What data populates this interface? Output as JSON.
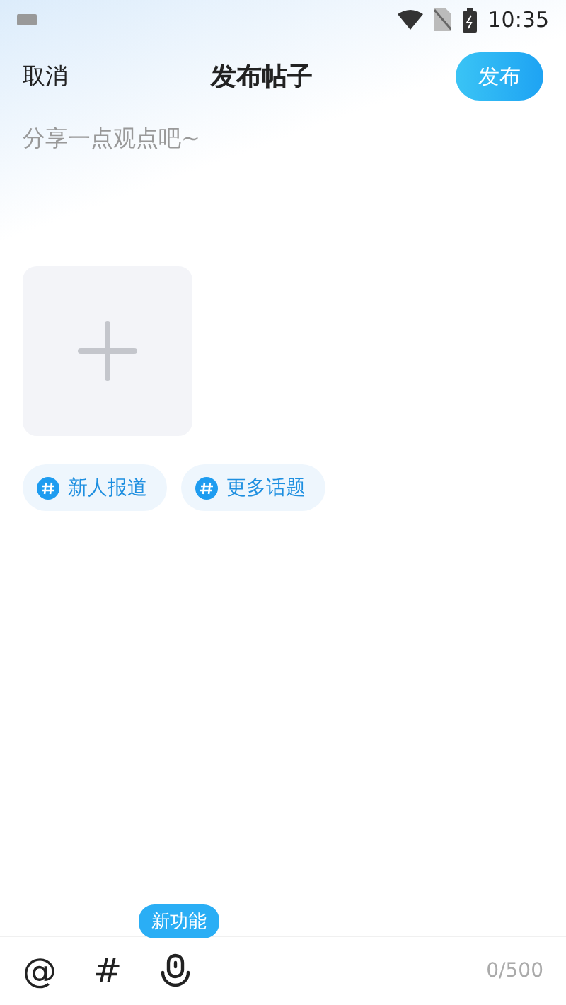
{
  "status_bar": {
    "time": "10:35"
  },
  "header": {
    "cancel": "取消",
    "title": "发布帖子",
    "publish": "发布"
  },
  "editor": {
    "placeholder": "分享一点观点吧~"
  },
  "topics": [
    {
      "label": "新人报道"
    },
    {
      "label": "更多话题"
    }
  ],
  "toolbar": {
    "tools": [
      {
        "kind": "mention",
        "label": "@"
      },
      {
        "kind": "hashtag",
        "label": "#"
      },
      {
        "kind": "voice"
      }
    ],
    "tooltip": "新功能",
    "counter": "0/500"
  }
}
